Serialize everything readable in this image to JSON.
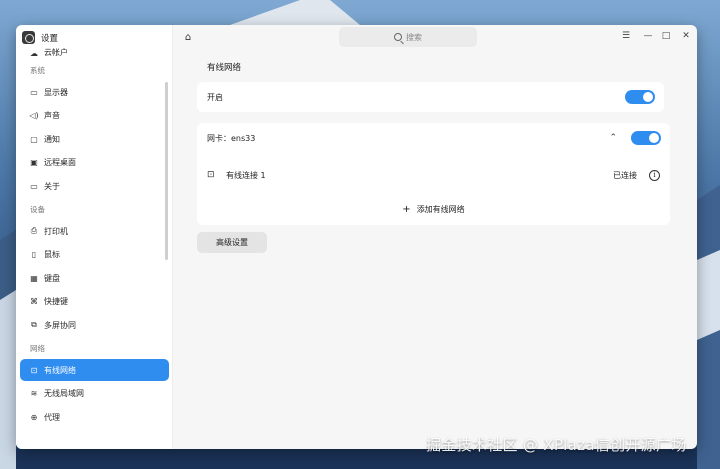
{
  "app": {
    "title": "设置"
  },
  "search": {
    "placeholder": "搜索"
  },
  "sidebar": {
    "partial_item": "云帐户",
    "sections": [
      {
        "label": "系统",
        "items": [
          {
            "label": "显示器",
            "icon": "monitor-icon",
            "glyph": "▭"
          },
          {
            "label": "声音",
            "icon": "speaker-icon",
            "glyph": "◁)"
          },
          {
            "label": "通知",
            "icon": "notification-icon",
            "glyph": "▢"
          },
          {
            "label": "远程桌面",
            "icon": "remote-desktop-icon",
            "glyph": "▣"
          },
          {
            "label": "关于",
            "icon": "about-icon",
            "glyph": "▭"
          }
        ]
      },
      {
        "label": "设备",
        "items": [
          {
            "label": "打印机",
            "icon": "printer-icon",
            "glyph": "⎙"
          },
          {
            "label": "鼠标",
            "icon": "mouse-icon",
            "glyph": "▯"
          },
          {
            "label": "键盘",
            "icon": "keyboard-icon",
            "glyph": "▦"
          },
          {
            "label": "快捷键",
            "icon": "shortcut-icon",
            "glyph": "⌘"
          },
          {
            "label": "多屏协同",
            "icon": "multi-screen-icon",
            "glyph": "⧉"
          }
        ]
      },
      {
        "label": "网络",
        "items": [
          {
            "label": "有线网络",
            "icon": "wired-network-icon",
            "glyph": "⊡",
            "active": true
          },
          {
            "label": "无线局域网",
            "icon": "wifi-icon",
            "glyph": "≋"
          },
          {
            "label": "代理",
            "icon": "proxy-icon",
            "glyph": "⊕"
          }
        ]
      }
    ]
  },
  "main": {
    "page_title": "有线网络",
    "enable": {
      "label": "开启",
      "state": true
    },
    "adapter": {
      "label": "网卡：ens33",
      "state": true,
      "expanded": true
    },
    "connection": {
      "name": "有线连接 1",
      "status": "已连接",
      "info_glyph": "i"
    },
    "add_label": "添加有线网络",
    "advanced_label": "高级设置"
  },
  "watermark": "掘金技术社区 @ XPlaza信创开源广场",
  "colors": {
    "accent": "#2f8df0"
  }
}
